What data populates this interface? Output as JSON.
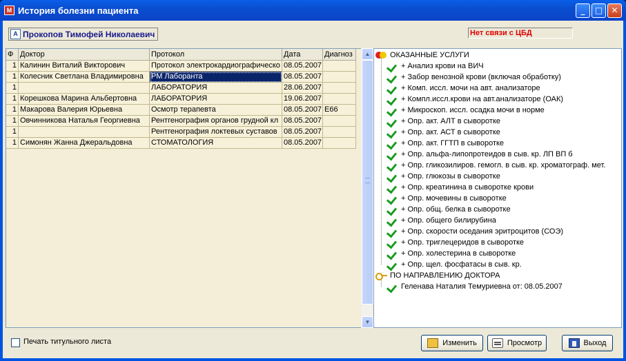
{
  "window": {
    "title": "История болезни пациента",
    "minimize_label": "_",
    "maximize_label": "□",
    "close_label": "✕"
  },
  "patient": {
    "name": "Прокопов Тимофей Николаевич"
  },
  "status": {
    "text": "Нет связи с ЦБД",
    "color": "#e00000"
  },
  "grid": {
    "columns": [
      "Ф",
      "Доктор",
      "Протокол",
      "Дата",
      "Диагноз"
    ],
    "rows": [
      [
        "1",
        "Калинин Виталий Викторович",
        "Протокол электрокардиографическо",
        "08.05.2007",
        ""
      ],
      [
        "1",
        "Колесник Светлана Владимировна",
        "РМ Лаборанта",
        "08.05.2007",
        ""
      ],
      [
        "1",
        "",
        "ЛАБОРАТОРИЯ",
        "28.06.2007",
        ""
      ],
      [
        "1",
        "Корешкова Марина Альбертовна",
        "ЛАБОРАТОРИЯ",
        "19.06.2007",
        ""
      ],
      [
        "1",
        "Макарова Валерия Юрьевна",
        "Осмотр терапевта",
        "08.05.2007",
        "E66"
      ],
      [
        "1",
        "Овчинникова Наталья Георгиевна",
        "Рентгенография органов грудной кл",
        "08.05.2007",
        ""
      ],
      [
        "1",
        "",
        "Рентгенография локтевых суставов",
        "08.05.2007",
        ""
      ],
      [
        "1",
        "Симонян Жанна Джеральдовна",
        "СТОМАТОЛОГИЯ",
        "08.05.2007",
        ""
      ]
    ],
    "selected_row": 1
  },
  "tree": {
    "services_group": "ОКАЗАННЫЕ УСЛУГИ",
    "services": [
      "+ Анализ крови на ВИЧ",
      "+ Забор венозной крови (включая обработку)",
      "+ Комп. иссл. мочи на авт. анализаторе",
      "+ Компл.иссл.крови на авт.анализаторе (ОАК)",
      "+ Микроскоп. иссл. осадка мочи в норме",
      "+ Опр. акт. АЛТ в сыворотке",
      "+ Опр. акт. АСТ в сыворотке",
      "+ Опр. акт. ГГТП в сыворотке",
      "+ Опр. альфа-липопротеидов в сыв. кр. ЛП ВП б",
      "+ Опр. гликозилиров. гемогл. в сыв. кр. хроматограф. мет.",
      "+ Опр. глюкозы в сыворотке",
      "+ Опр. креатинина в сыворотке крови",
      "+ Опр. мочевины в сыворотке",
      "+ Опр. общ. белка в сыворотке",
      "+ Опр. общего билирубина",
      "+ Опр. скорости оседания эритроцитов (СОЭ)",
      "+ Опр. триглецеридов в сыворотке",
      "+ Опр. холестерина в сыворотке",
      "+ Опр. щел. фосфатаcы в сыв. кр."
    ],
    "referral_group": "ПО НАПРАВЛЕНИЮ ДОКТОРА",
    "referrals": [
      "Геленава Наталия Темуриевна  от: 08.05.2007"
    ]
  },
  "footer": {
    "print_title_label": "Печать титульного листа",
    "edit_label": "Изменить",
    "view_label": "Просмотр",
    "exit_label": "Выход"
  }
}
